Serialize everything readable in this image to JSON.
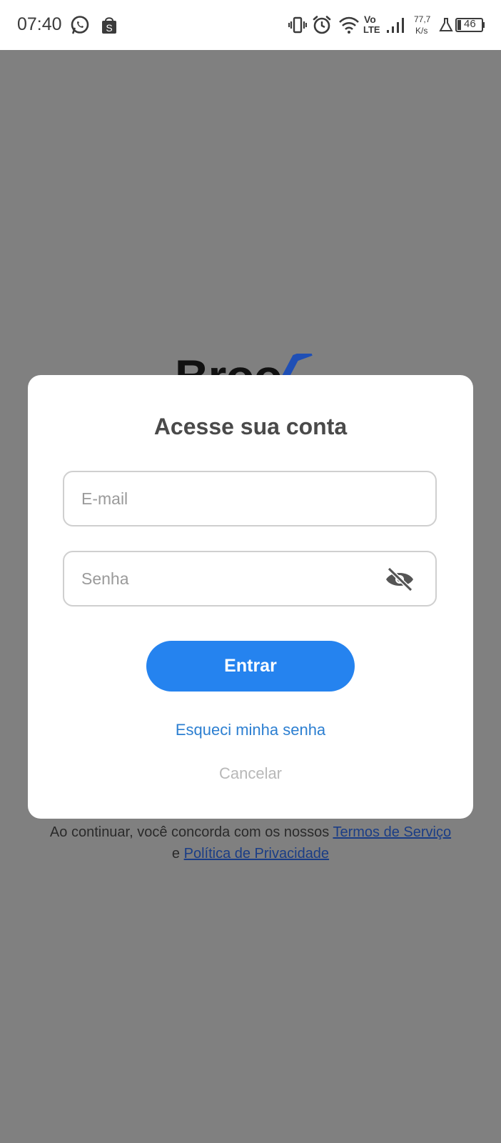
{
  "status_bar": {
    "time": "07:40",
    "volte_top": "Vo",
    "volte_bottom": "LTE",
    "speed_value": "77,7",
    "speed_unit": "K/s",
    "battery": "46"
  },
  "background": {
    "logo_text": "Broo"
  },
  "modal": {
    "title": "Acesse sua conta",
    "email_placeholder": "E-mail",
    "email_value": "",
    "password_placeholder": "Senha",
    "password_value": "",
    "submit_label": "Entrar",
    "forgot_label": "Esqueci minha senha",
    "cancel_label": "Cancelar"
  },
  "footer": {
    "prefix": "Ao continuar, você concorda com os nossos ",
    "terms_link": "Termos de Serviço",
    "connector": "e ",
    "privacy_link": "Política de Privacidade"
  },
  "colors": {
    "primary": "#2583ef",
    "link": "#2c7fd1",
    "overlay": "#808080",
    "logo_accent": "#1f4fb5"
  }
}
